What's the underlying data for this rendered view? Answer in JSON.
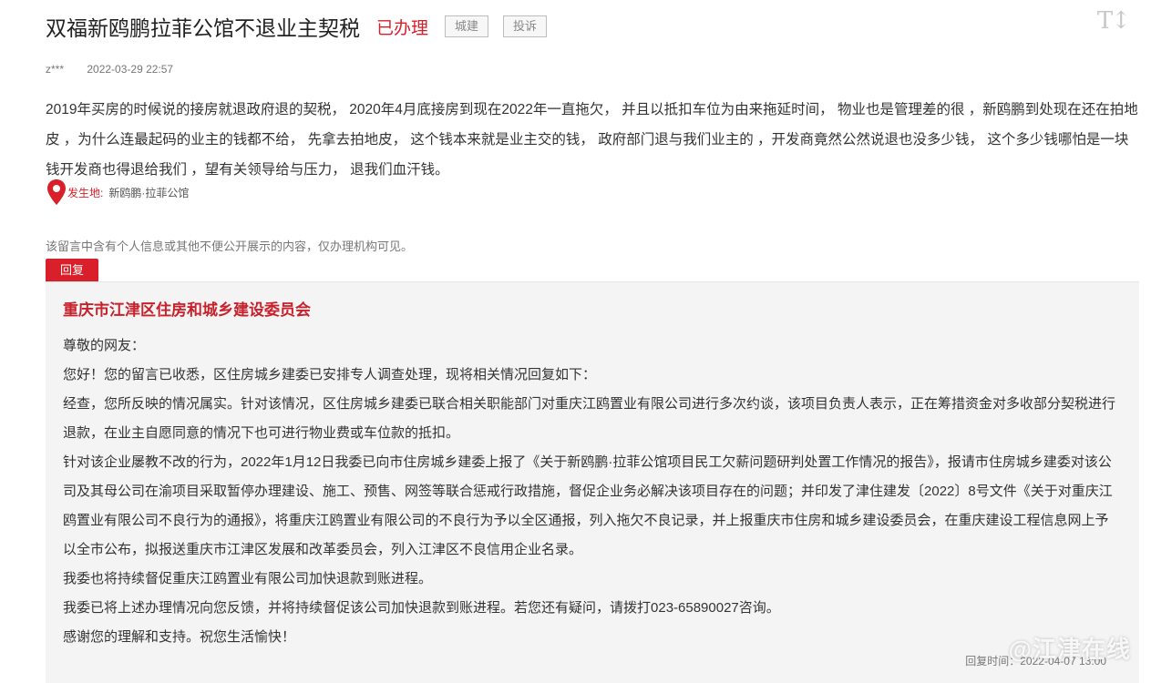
{
  "post": {
    "title": "双福新鸥鹏拉菲公馆不退业主契税",
    "status": "已办理",
    "category_tag": "城建",
    "type_tag": "投诉",
    "font_size_icon": "T↕",
    "author": "z***",
    "date": "2022-03-29 22:57",
    "content": "2019年买房的时候说的接房就退政府退的契税， 2020年4月底接房到现在2022年一直拖欠， 并且以抵扣车位为由来拖延时间， 物业也是管理差的很 ，新鸥鹏到处现在还在拍地皮 ，为什么连最起码的业主的钱都不给， 先拿去拍地皮， 这个钱本来就是业主交的钱， 政府部门退与我们业主的 ，开发商竟然公然说退也没多少钱， 这个多少钱哪怕是一块钱开发商也得退给我们 ，望有关领导给与压力， 退我们血汗钱。",
    "location_label": "发生地:",
    "location_value": "新鸥鹏·拉菲公馆",
    "privacy_notice": "该留言中含有个人信息或其他不便公开展示的内容，仅办理机构可见。"
  },
  "reply": {
    "tab_label": "回复",
    "department": "重庆市江津区住房和城乡建设委员会",
    "paragraphs": [
      "尊敬的网友：",
      "您好！您的留言已收悉，区住房城乡建委已安排专人调查处理，现将相关情况回复如下：",
      "经查，您所反映的情况属实。针对该情况，区住房城乡建委已联合相关职能部门对重庆江鸥置业有限公司进行多次约谈，该项目负责人表示，正在筹措资金对多收部分契税进行退款，在业主自愿同意的情况下也可进行物业费或车位款的抵扣。",
      "针对该企业屡教不改的行为，2022年1月12日我委已向市住房城乡建委上报了《关于新鸥鹏·拉菲公馆项目民工欠薪问题研判处置工作情况的报告》，报请市住房城乡建委对该公司及其母公司在渝项目采取暂停办理建设、施工、预售、网签等联合惩戒行政措施，督促企业务必解决该项目存在的问题；并印发了津住建发〔2022〕8号文件《关于对重庆江鸥置业有限公司不良行为的通报》，将重庆江鸥置业有限公司的不良行为予以全区通报，列入拖欠不良记录，并上报重庆市住房和城乡建设委员会，在重庆建设工程信息网上予以全市公布，拟报送重庆市江津区发展和改革委员会，列入江津区不良信用企业名录。",
      "我委也将持续督促重庆江鸥置业有限公司加快退款到账进程。",
      "我委已将上述办理情况向您反馈，并将持续督促该公司加快退款到账进程。若您还有疑问，请拨打023-65890027咨询。",
      "感谢您的理解和支持。祝您生活愉快！"
    ],
    "time": "回复时间：2022-04-07 13:00"
  },
  "watermark": "@江津在线",
  "colors": {
    "accent": "#d9202a",
    "reply_bg": "#f4f4f4"
  },
  "icons": {
    "location": "map-pin-icon",
    "font_size": "font-size-icon"
  }
}
